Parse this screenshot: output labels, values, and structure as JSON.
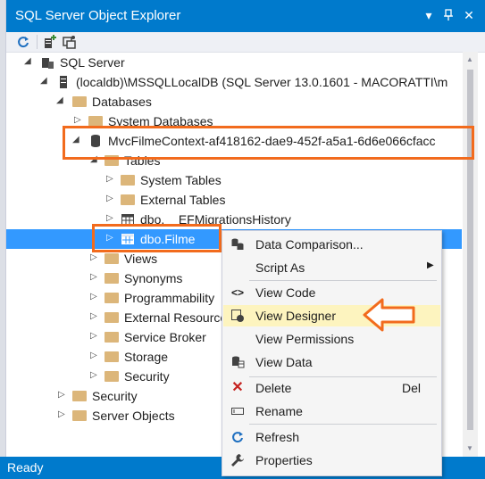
{
  "window": {
    "title": "SQL Server Object Explorer"
  },
  "titlebar": {
    "pin_icon": "pin-icon",
    "close_icon": "close-icon",
    "dropdown_icon": "chevron-down-icon"
  },
  "tree": {
    "sql_server": "SQL Server",
    "instance": "(localdb)\\MSSQLLocalDB (SQL Server 13.0.1601 - MACORATTI\\m",
    "databases": "Databases",
    "system_databases": "System Databases",
    "db_name": "MvcFilmeContext-af418162-dae9-452f-a5a1-6d6e066cfacc",
    "tables": "Tables",
    "system_tables": "System Tables",
    "external_tables": "External Tables",
    "ef_history": "dbo.__EFMigrationsHistory",
    "filme": "dbo.Filme",
    "views": "Views",
    "synonyms": "Synonyms",
    "programmability": "Programmability",
    "external_resources": "External Resources",
    "service_broker": "Service Broker",
    "storage": "Storage",
    "security_db": "Security",
    "security": "Security",
    "server_objects": "Server Objects"
  },
  "context_menu": {
    "data_comparison": "Data Comparison...",
    "script_as": "Script As",
    "view_code": "View Code",
    "view_designer": "View Designer",
    "view_permissions": "View Permissions",
    "view_data": "View Data",
    "delete": "Delete",
    "delete_shortcut": "Del",
    "rename": "Rename",
    "refresh": "Refresh",
    "properties": "Properties"
  },
  "status": {
    "text": "Ready"
  },
  "colors": {
    "accent": "#007acc",
    "highlight": "#f26b1d",
    "selection": "#3399ff"
  }
}
